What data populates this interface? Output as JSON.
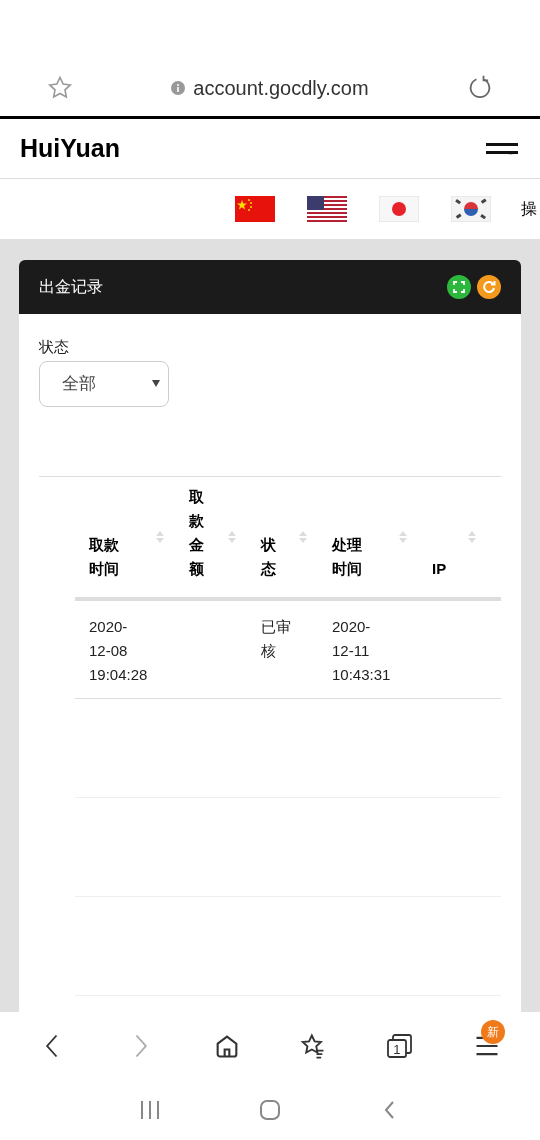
{
  "browser": {
    "url": "account.gocdly.com"
  },
  "header": {
    "brand": "HuiYuan"
  },
  "languages": {
    "flags": [
      {
        "kind": "cn"
      },
      {
        "kind": "us"
      },
      {
        "kind": "jp"
      },
      {
        "kind": "kr"
      }
    ],
    "cut_label": "操"
  },
  "card": {
    "title": "出金记录",
    "filter": {
      "label": "状态",
      "value": "全部"
    },
    "table": {
      "columns": [
        "取款时间",
        "取款金额",
        "状态",
        "处理时间",
        "IP"
      ],
      "rows": [
        [
          "2020-\n12-08\n19:04:28",
          "",
          "已审核",
          "2020-\n12-11\n10:43:31",
          ""
        ]
      ]
    }
  },
  "bottom_nav": {
    "tab_count": "1",
    "menu_badge": "新"
  }
}
